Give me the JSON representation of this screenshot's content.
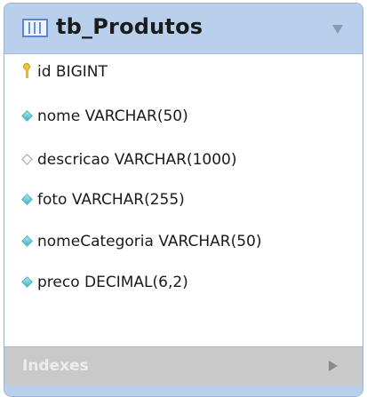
{
  "table": {
    "name": "tb_Produtos",
    "header_color": "#b8d0ec",
    "icon": "table-icon",
    "collapse_icon": "triangle-down-icon"
  },
  "columns": [
    {
      "text": "id BIGINT",
      "marker": "primary-key-icon"
    },
    {
      "text": "nome VARCHAR(50)",
      "marker": "filled-diamond-icon"
    },
    {
      "text": "descricao VARCHAR(1000)",
      "marker": "hollow-diamond-icon"
    },
    {
      "text": "foto VARCHAR(255)",
      "marker": "filled-diamond-icon"
    },
    {
      "text": "nomeCategoria VARCHAR(50)",
      "marker": "filled-diamond-icon"
    },
    {
      "text": "preco DECIMAL(6,2)",
      "marker": "filled-diamond-icon"
    }
  ],
  "indexes": {
    "label": "Indexes",
    "expand_icon": "triangle-right-icon"
  }
}
